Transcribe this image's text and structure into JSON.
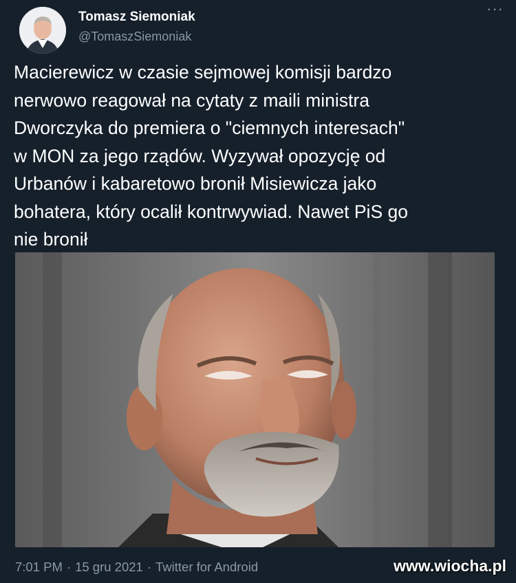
{
  "author": {
    "display_name": "Tomasz Siemoniak",
    "handle": "@TomaszSiemoniak"
  },
  "menu": {
    "more_icon": "more-horizontal-icon",
    "glyph": "···"
  },
  "tweet": {
    "text": "Macierewicz w czasie sejmowej komisji bardzo\nnerwowo reagował na cytaty z maili ministra\nDworczyka do premiera o \"ciemnych interesach\"\nw MON za jego rządów. Wyzywał opozycję od\nUrbanów i kabaretowo bronił Misiewicza jako\nbohatera, który ocalił kontrwywiad. Nawet PiS go\nnie bronił"
  },
  "meta": {
    "time": "7:01 PM",
    "separator": "·",
    "date": "15 gru 2021",
    "source": "Twitter for Android"
  },
  "watermark": "www.wiocha.pl",
  "colors": {
    "background": "#15202b",
    "primary_text": "#ffffff",
    "secondary_text": "#8899a6"
  }
}
